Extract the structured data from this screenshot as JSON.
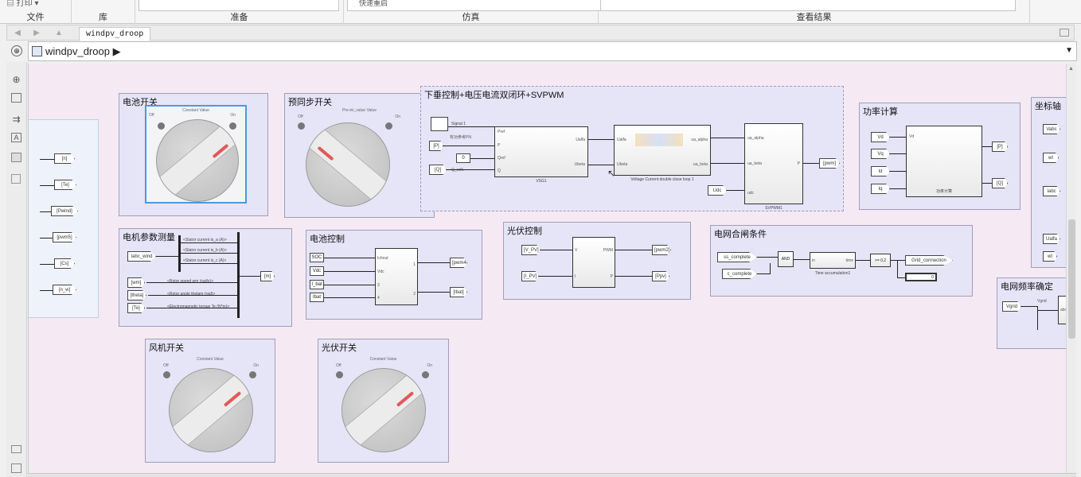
{
  "ribbon": {
    "sections": [
      {
        "label": "文件",
        "control": "打印"
      },
      {
        "label": "库"
      },
      {
        "label": "准备"
      },
      {
        "label": "仿真",
        "control": "快速重启"
      },
      {
        "label": "查看结果"
      }
    ]
  },
  "tab": {
    "name": "windpv_droop"
  },
  "address": {
    "path": "windpv_droop"
  },
  "subsystems": {
    "battery_switch": {
      "title": "电池开关",
      "knob_caption": "Constant Value",
      "left_label": "Off",
      "right_label": "On"
    },
    "presync_switch": {
      "title": "预同步开关",
      "knob_caption": "Pre-ini_value Value",
      "left_label": "Off",
      "right_label": "On"
    },
    "droop_control": {
      "title": "下垂控制+电压电流双闭环+SVPWM",
      "block1_label": "VSG1",
      "block2_label": "Voltage Current double close loop 1",
      "block3_label": "SVPWM1",
      "inputs": [
        "[P]",
        "[Q]"
      ],
      "step_label": "Signal 1",
      "p_ref": "有功参考PN",
      "q_ref": "Q_ref1",
      "const_0": "0",
      "udc": "Udc",
      "output": "[pwm]",
      "b1_ports_in": [
        "Pref",
        "P",
        "Qref",
        "Q"
      ],
      "b1_ports_out": [
        "Ualfa",
        "Ubeta"
      ],
      "b2_ports_in": [
        "Ualfa",
        "Ubeta"
      ],
      "b2_ports_out": [
        "ua_alpha",
        "ua_beta"
      ],
      "b3_ports_in": [
        "ua_alpha",
        "ua_beta",
        "udc"
      ],
      "b3_ports_out": [
        "P"
      ]
    },
    "power_calc": {
      "title": "功率计算",
      "inputs": [
        "Vd",
        "Vq",
        "Id",
        "Iq"
      ],
      "outputs": [
        "[P]",
        "[Q]"
      ],
      "block_label": "功率计算"
    },
    "coord": {
      "title": "坐标轴",
      "ports": [
        "Vabc",
        "wt",
        "Iabc",
        "Ualfa",
        "wt"
      ]
    },
    "left_goto": {
      "tags": [
        "[n]",
        "[Te]",
        "[Pwind]",
        "[pwm5]",
        "[Cs]",
        "[n_w]"
      ]
    },
    "motor_measure": {
      "title": "电机参数测量",
      "bus_signals": [
        "<Stator current is_a (A)>",
        "<Stator current is_b (A)>",
        "<Stator current is_c (A)>",
        "<Rotor speed wm (rad/s)>",
        "<Rotor angle thetam (rad)>",
        "<Electromagnetic torque Te (N*m)>"
      ],
      "outputs": [
        "Iabc_wind",
        "[wm]",
        "[theta]",
        "[Te]"
      ],
      "input": "[m]"
    },
    "battery_control": {
      "title": "电池控制",
      "inputs": [
        "SOC",
        "Vdc",
        "I_bat",
        "Ibat"
      ],
      "outputs": [
        "[pwm4]",
        "[Ibat]"
      ],
      "port_labels": [
        "Ichout",
        "Vdc",
        "3",
        "4"
      ],
      "out_labels": [
        "1",
        "2"
      ]
    },
    "pv_control": {
      "title": "光伏控制",
      "inputs": [
        "[V_PV]",
        "[I_PV]"
      ],
      "outputs": [
        "[pwm2]",
        "[Ppv]"
      ],
      "port_labels": [
        "V",
        "I"
      ],
      "out_labels": [
        "PWM",
        "P"
      ]
    },
    "grid_cond": {
      "title": "电网合闸条件",
      "inputs": [
        "ss_complete",
        "c_complete"
      ],
      "and_label": "AND",
      "timer_label": "Time accumulation1",
      "timer_port_in": "in",
      "timer_port_out": "time",
      "compare_label": ">= 0.2",
      "output": "Grid_connection",
      "display": "0"
    },
    "grid_freq": {
      "title": "电网频率确定",
      "input": "Vgrid",
      "port": "Vgrid",
      "block_port": "abc"
    },
    "wind_switch": {
      "title": "风机开关",
      "knob_caption": "Constant Value",
      "left_label": "Off",
      "right_label": "On"
    },
    "pv_switch": {
      "title": "光伏开关",
      "knob_caption": "Constant Value",
      "left_label": "Off",
      "right_label": "On"
    }
  },
  "colors": {
    "canvas": "#f5eaf4",
    "subsystem": "#e6e4f7",
    "selection": "#4a9be0",
    "knob_mark": "#e05a5a"
  }
}
